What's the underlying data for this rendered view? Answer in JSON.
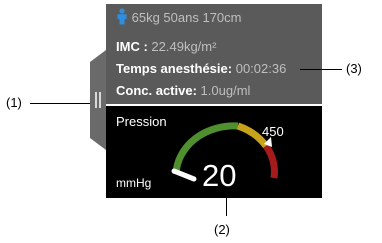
{
  "callouts": {
    "left": "(1)",
    "bottom": "(2)",
    "right": "(3)"
  },
  "patient": {
    "summary": "65kg 50ans 170cm",
    "imc_label": "IMC :",
    "imc_value": "22.49kg/m²",
    "anesthesia_label": "Temps anesthésie:",
    "anesthesia_value": "00:02:36",
    "conc_label": "Conc. active:",
    "conc_value": "1.0ug/ml"
  },
  "pressure": {
    "title": "Pression",
    "unit": "mmHg",
    "value": "20",
    "max_label": "450"
  },
  "icons": {
    "patient": "person-icon",
    "handle": "grip-handle-icon",
    "marker": "triangle-marker-icon"
  },
  "colors": {
    "panel_top_bg": "#5a5a5a",
    "panel_bottom_bg": "#000000",
    "gauge_green": "#4f8f2f",
    "gauge_yellow": "#c9a21c",
    "gauge_red": "#a51b1b",
    "person_icon": "#2f8ee0"
  }
}
